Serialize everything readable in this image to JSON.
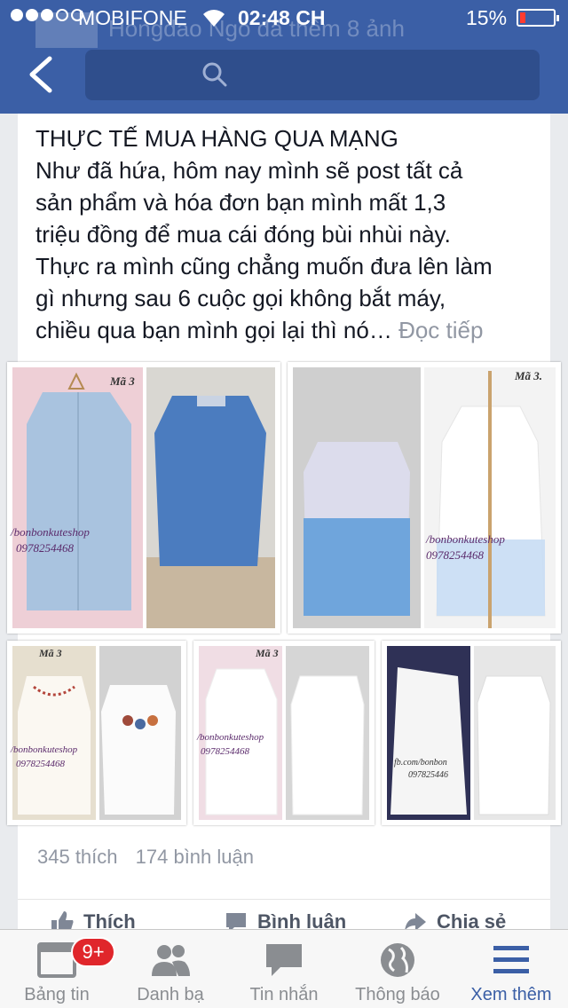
{
  "status_bar": {
    "carrier": "MOBIFONE",
    "time": "02:48 CH",
    "battery": "15%",
    "battery_color": "#ff3b30"
  },
  "header": {
    "background_color": "#3b5fa6",
    "ghost_text": "Hongdao Ngo đã thêm 8 ảnh",
    "back_icon": "back-chevron-icon",
    "search_icon": "search-icon",
    "search_value": ""
  },
  "post": {
    "lines": [
      "THỰC TẾ MUA HÀNG QUA MẠNG",
      "Như đã hứa, hôm nay mình sẽ post tất cả",
      "sản phẩm và hóa đơn bạn mình mất 1,3",
      "triệu đồng để mua cái đóng bùi nhùi này.",
      "Thực ra mình cũng chẳng muốn đưa lên làm",
      "gì nhưng sau 6 cuộc gọi không bắt máy,",
      "chiều qua bạn mình gọi lại thì nó…"
    ],
    "read_more": "Đọc tiếp",
    "photos": [
      {
        "watermark_code": "Mã 3",
        "shop": "/bonbonkuteshop",
        "phone": "0978254468"
      },
      {
        "watermark_code": "Mã 3.",
        "shop": "/bonbonkuteshop",
        "phone": "0978254468"
      },
      {
        "watermark_code": "Mã 3",
        "shop": "/bonbonkuteshop",
        "phone": "0978254468"
      },
      {
        "watermark_code": "Mã 3",
        "shop": "/bonbonkuteshop",
        "phone": "0978254468"
      },
      {
        "watermark_code": "",
        "shop": "fb.com/bonbon",
        "phone": "097825446"
      }
    ],
    "likes": "345 thích",
    "comments": "174 bình luận",
    "actions": {
      "like": "Thích",
      "comment": "Bình luận",
      "share": "Chia sẻ"
    }
  },
  "tabbar": {
    "active_color": "#3b5fa6",
    "tabs": [
      {
        "label": "Bảng tin",
        "icon": "news-feed-icon",
        "badge": "9+"
      },
      {
        "label": "Danh bạ",
        "icon": "contacts-icon"
      },
      {
        "label": "Tin nhắn",
        "icon": "messages-icon"
      },
      {
        "label": "Thông báo",
        "icon": "globe-icon"
      },
      {
        "label": "Xem thêm",
        "icon": "menu-icon"
      }
    ]
  }
}
